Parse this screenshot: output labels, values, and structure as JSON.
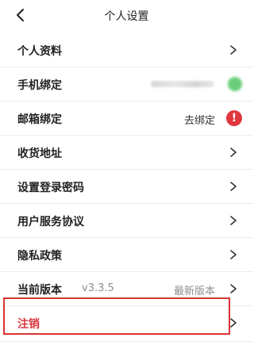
{
  "header": {
    "title": "个人设置",
    "back_icon": "chevron-left-icon"
  },
  "rows": [
    {
      "label": "个人资料",
      "icon": "chevron-right-icon"
    },
    {
      "label": "手机绑定",
      "status_color": "#6cce7a"
    },
    {
      "label": "邮箱绑定",
      "value": "去绑定",
      "status_icon": "warning-icon",
      "status_glyph": "!",
      "status_color": "#e0363d"
    },
    {
      "label": "收货地址",
      "icon": "chevron-right-icon"
    },
    {
      "label": "设置登录密码",
      "icon": "chevron-right-icon"
    },
    {
      "label": "用户服务协议",
      "icon": "chevron-right-icon"
    },
    {
      "label": "隐私政策",
      "icon": "chevron-right-icon"
    },
    {
      "label": "当前版本",
      "version": "v3.3.5",
      "value": "最新版本",
      "icon": "chevron-right-icon"
    },
    {
      "label": "注销",
      "icon": "chevron-right-icon",
      "label_color": "#d9363e"
    }
  ],
  "colors": {
    "highlight": "#d83530",
    "divider": "#ececec"
  }
}
